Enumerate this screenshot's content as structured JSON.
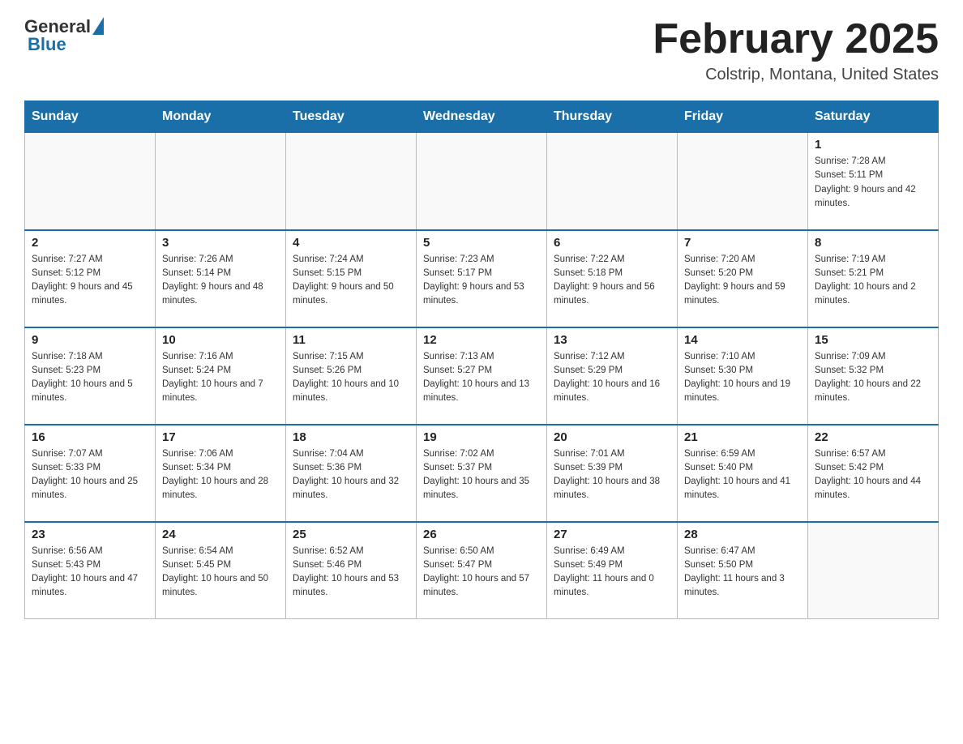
{
  "logo": {
    "general": "General",
    "blue": "Blue"
  },
  "header": {
    "title": "February 2025",
    "location": "Colstrip, Montana, United States"
  },
  "days_of_week": [
    "Sunday",
    "Monday",
    "Tuesday",
    "Wednesday",
    "Thursday",
    "Friday",
    "Saturday"
  ],
  "weeks": [
    [
      {
        "day": "",
        "info": ""
      },
      {
        "day": "",
        "info": ""
      },
      {
        "day": "",
        "info": ""
      },
      {
        "day": "",
        "info": ""
      },
      {
        "day": "",
        "info": ""
      },
      {
        "day": "",
        "info": ""
      },
      {
        "day": "1",
        "info": "Sunrise: 7:28 AM\nSunset: 5:11 PM\nDaylight: 9 hours and 42 minutes."
      }
    ],
    [
      {
        "day": "2",
        "info": "Sunrise: 7:27 AM\nSunset: 5:12 PM\nDaylight: 9 hours and 45 minutes."
      },
      {
        "day": "3",
        "info": "Sunrise: 7:26 AM\nSunset: 5:14 PM\nDaylight: 9 hours and 48 minutes."
      },
      {
        "day": "4",
        "info": "Sunrise: 7:24 AM\nSunset: 5:15 PM\nDaylight: 9 hours and 50 minutes."
      },
      {
        "day": "5",
        "info": "Sunrise: 7:23 AM\nSunset: 5:17 PM\nDaylight: 9 hours and 53 minutes."
      },
      {
        "day": "6",
        "info": "Sunrise: 7:22 AM\nSunset: 5:18 PM\nDaylight: 9 hours and 56 minutes."
      },
      {
        "day": "7",
        "info": "Sunrise: 7:20 AM\nSunset: 5:20 PM\nDaylight: 9 hours and 59 minutes."
      },
      {
        "day": "8",
        "info": "Sunrise: 7:19 AM\nSunset: 5:21 PM\nDaylight: 10 hours and 2 minutes."
      }
    ],
    [
      {
        "day": "9",
        "info": "Sunrise: 7:18 AM\nSunset: 5:23 PM\nDaylight: 10 hours and 5 minutes."
      },
      {
        "day": "10",
        "info": "Sunrise: 7:16 AM\nSunset: 5:24 PM\nDaylight: 10 hours and 7 minutes."
      },
      {
        "day": "11",
        "info": "Sunrise: 7:15 AM\nSunset: 5:26 PM\nDaylight: 10 hours and 10 minutes."
      },
      {
        "day": "12",
        "info": "Sunrise: 7:13 AM\nSunset: 5:27 PM\nDaylight: 10 hours and 13 minutes."
      },
      {
        "day": "13",
        "info": "Sunrise: 7:12 AM\nSunset: 5:29 PM\nDaylight: 10 hours and 16 minutes."
      },
      {
        "day": "14",
        "info": "Sunrise: 7:10 AM\nSunset: 5:30 PM\nDaylight: 10 hours and 19 minutes."
      },
      {
        "day": "15",
        "info": "Sunrise: 7:09 AM\nSunset: 5:32 PM\nDaylight: 10 hours and 22 minutes."
      }
    ],
    [
      {
        "day": "16",
        "info": "Sunrise: 7:07 AM\nSunset: 5:33 PM\nDaylight: 10 hours and 25 minutes."
      },
      {
        "day": "17",
        "info": "Sunrise: 7:06 AM\nSunset: 5:34 PM\nDaylight: 10 hours and 28 minutes."
      },
      {
        "day": "18",
        "info": "Sunrise: 7:04 AM\nSunset: 5:36 PM\nDaylight: 10 hours and 32 minutes."
      },
      {
        "day": "19",
        "info": "Sunrise: 7:02 AM\nSunset: 5:37 PM\nDaylight: 10 hours and 35 minutes."
      },
      {
        "day": "20",
        "info": "Sunrise: 7:01 AM\nSunset: 5:39 PM\nDaylight: 10 hours and 38 minutes."
      },
      {
        "day": "21",
        "info": "Sunrise: 6:59 AM\nSunset: 5:40 PM\nDaylight: 10 hours and 41 minutes."
      },
      {
        "day": "22",
        "info": "Sunrise: 6:57 AM\nSunset: 5:42 PM\nDaylight: 10 hours and 44 minutes."
      }
    ],
    [
      {
        "day": "23",
        "info": "Sunrise: 6:56 AM\nSunset: 5:43 PM\nDaylight: 10 hours and 47 minutes."
      },
      {
        "day": "24",
        "info": "Sunrise: 6:54 AM\nSunset: 5:45 PM\nDaylight: 10 hours and 50 minutes."
      },
      {
        "day": "25",
        "info": "Sunrise: 6:52 AM\nSunset: 5:46 PM\nDaylight: 10 hours and 53 minutes."
      },
      {
        "day": "26",
        "info": "Sunrise: 6:50 AM\nSunset: 5:47 PM\nDaylight: 10 hours and 57 minutes."
      },
      {
        "day": "27",
        "info": "Sunrise: 6:49 AM\nSunset: 5:49 PM\nDaylight: 11 hours and 0 minutes."
      },
      {
        "day": "28",
        "info": "Sunrise: 6:47 AM\nSunset: 5:50 PM\nDaylight: 11 hours and 3 minutes."
      },
      {
        "day": "",
        "info": ""
      }
    ]
  ]
}
